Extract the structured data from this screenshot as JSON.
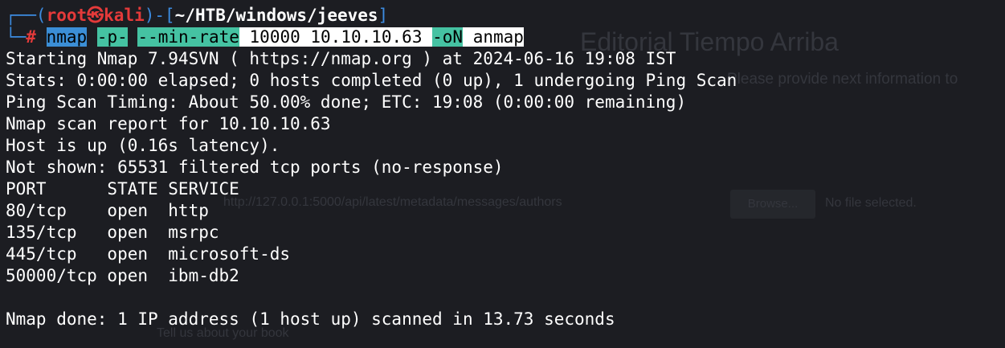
{
  "background_page": {
    "title": "Editorial Tiempo Arriba",
    "subtitle": "Please provide next information to",
    "url_text": "http://127.0.0.1:5000/api/latest/metadata/messages/authors",
    "browse_button": "Browse...",
    "no_file": "No file selected.",
    "textarea_hint": "Tell us about your book"
  },
  "prompt": {
    "corner_top": "┌──(",
    "user": "root",
    "skull": "㉿",
    "host": "kali",
    "close_bracket": ")-[",
    "path": "~/HTB/windows/jeeves",
    "path_end": "]",
    "corner_bottom": "└─",
    "symbol": "#"
  },
  "command": {
    "tokens": [
      {
        "text": "nmap",
        "kind": "cmd"
      },
      {
        "text": "-p-",
        "kind": "opt"
      },
      {
        "text": "--min-rate",
        "kind": "opt"
      },
      {
        "text": "10000 10.10.10.63",
        "kind": "arg"
      },
      {
        "text": "-oN",
        "kind": "opt"
      },
      {
        "text": "anmap",
        "kind": "arg"
      }
    ]
  },
  "output_lines": [
    "Starting Nmap 7.94SVN ( https://nmap.org ) at 2024-06-16 19:08 IST",
    "Stats: 0:00:00 elapsed; 0 hosts completed (0 up), 1 undergoing Ping Scan",
    "Ping Scan Timing: About 50.00% done; ETC: 19:08 (0:00:00 remaining)",
    "Nmap scan report for 10.10.10.63",
    "Host is up (0.16s latency).",
    "Not shown: 65531 filtered tcp ports (no-response)",
    "PORT      STATE SERVICE",
    "80/tcp    open  http",
    "135/tcp   open  msrpc",
    "445/tcp   open  microsoft-ds",
    "50000/tcp open  ibm-db2",
    "",
    "Nmap done: 1 IP address (1 host up) scanned in 13.73 seconds"
  ],
  "colors": {
    "background": "#1c1d22",
    "prompt_blue": "#3c8be0",
    "prompt_red": "#e43a3a",
    "highlight_cmd": "#3b8ed6",
    "highlight_opt": "#45c2a2",
    "highlight_arg": "#ffffff"
  }
}
